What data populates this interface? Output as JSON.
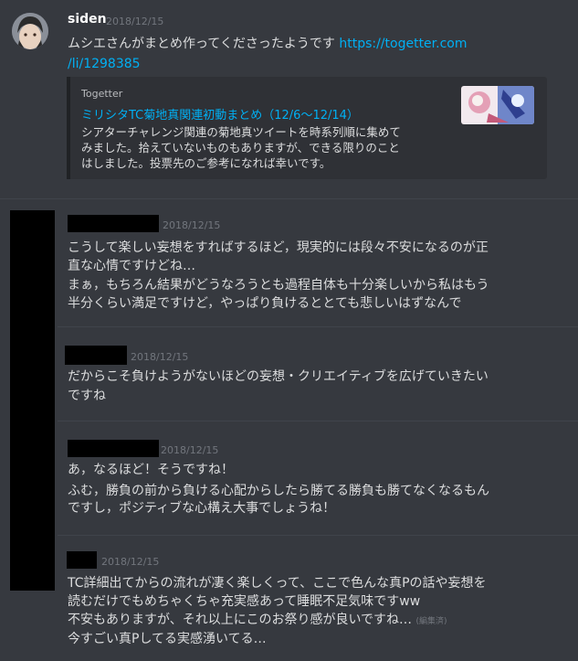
{
  "message1": {
    "username": "siden",
    "timestamp": "2018/12/15",
    "text": "ムシエさんがまとめ作ってくださったようです",
    "link_line1": "https://togetter.com",
    "link_line2": "/li/1298385",
    "embed": {
      "provider": "Togetter",
      "title": "ミリシタTC菊地真関連初動まとめ（12/6〜12/14）",
      "description_lines": [
        "シアターチャレンジ関連の菊地真ツイートを時系列順に集めて",
        "みました。拾えていないものもありますが、できる限りのこと",
        "はしました。投票先のご参考になれば幸いです。"
      ]
    }
  },
  "message2": {
    "timestamp": "2018/12/15",
    "lines": [
      "こうして楽しい妄想をすればするほど，現実的には段々不安になるのが正",
      "直な心情ですけどね…",
      "まぁ，もちろん結果がどうなろうとも過程自体も十分楽しいから私はもう",
      "半分くらい満足ですけど，やっぱり負けるととても悲しいはずなんで"
    ]
  },
  "message3": {
    "timestamp": "2018/12/15",
    "lines": [
      "だからこそ負けようがないほどの妄想・クリエイティブを広げていきたい",
      "ですね"
    ]
  },
  "message4": {
    "timestamp": "2018/12/15",
    "lines": [
      "あ，なるほど！そうですね！",
      "ふむ，勝負の前から負ける心配からしたら勝てる勝負も勝てなくなるもん",
      "ですし，ポジティブな心構え大事でしょうね！"
    ]
  },
  "message5": {
    "timestamp": "2018/12/15",
    "lines": [
      "TC詳細出てからの流れが凄く楽しくって、ここで色んな真Pの話や妄想を",
      "読むだけでもめちゃくちゃ充実感あって睡眠不足気味ですww",
      "不安もありますが、それ以上にこのお祭り感が良いですね…",
      "今すごい真Pしてる実感湧いてる…"
    ],
    "edited_label": "(編集済)"
  }
}
